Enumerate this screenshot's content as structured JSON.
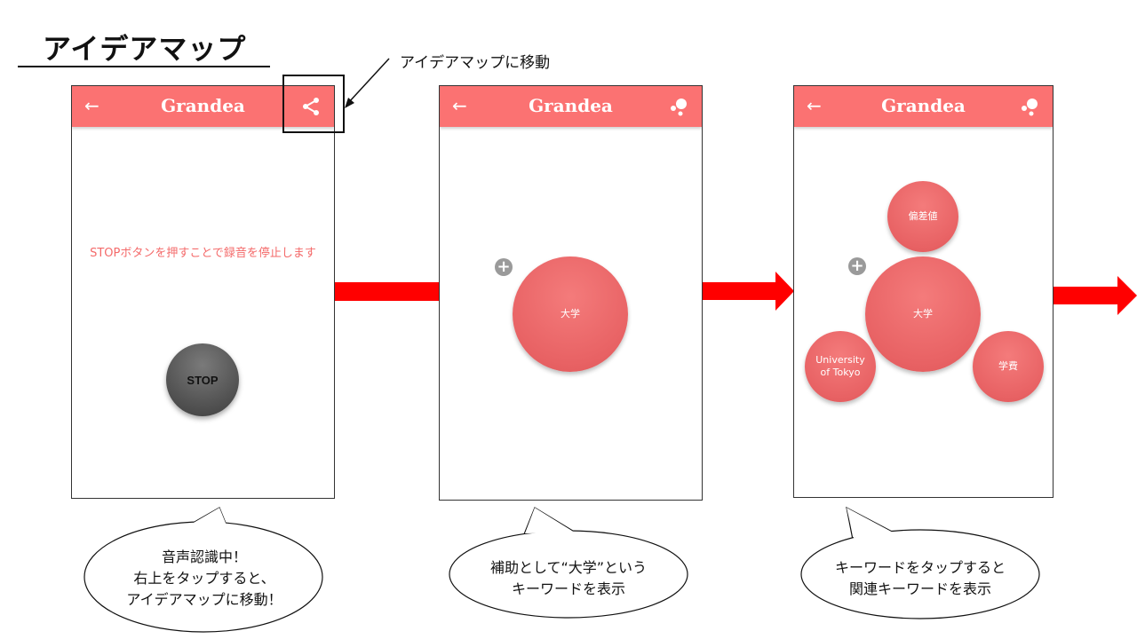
{
  "slide": {
    "title": "アイデアマップ",
    "callout": "アイデアマップに移動"
  },
  "app": {
    "name": "Grandea",
    "back_icon": "arrow-left-icon",
    "share_icon": "share-icon",
    "bubbles_icon": "bubbles-icon",
    "accent_color": "#fb7272",
    "bubble_color": "#e86264"
  },
  "screen1": {
    "message": "STOPボタンを押すことで録音を停止します",
    "stop_label": "STOP"
  },
  "screen2": {
    "center_keyword": "大学"
  },
  "screen3": {
    "center_keyword": "大学",
    "related": [
      "偏差値",
      "University of Tokyo",
      "学費"
    ]
  },
  "balloons": [
    {
      "lines": [
        "音声認識中！",
        "右上をタップすると、",
        "アイデアマップに移動！"
      ]
    },
    {
      "lines": [
        "補助として“大学”という",
        "キーワードを表示"
      ]
    },
    {
      "lines": [
        "キーワードをタップすると",
        "関連キーワードを表示"
      ]
    }
  ]
}
